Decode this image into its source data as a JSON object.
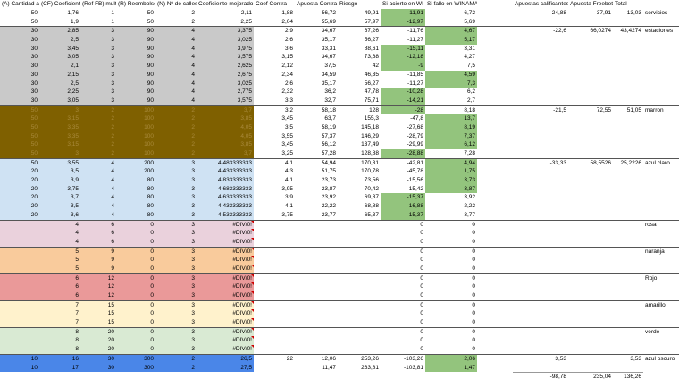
{
  "headers": [
    "(A) Cantidad a",
    "(CF) Coeficient",
    "(Ref FB) multipli",
    "(R) Reembolso",
    "(N) Nº de calles",
    "Coeficiente mejorado",
    "Coef Contra",
    "Apuesta Contra",
    "Riesgo",
    "Si acierto en WI",
    "Si fallo en WINAMAX",
    "",
    "Apuestas calificantes",
    "Apuesta Freebet",
    "Total",
    ""
  ],
  "colors": {
    "gray": "#c9c9c9",
    "brown": "#7f6000",
    "brownText": "#a8893a",
    "lightblue": "#cfe2f3",
    "pink": "#ead1dc",
    "orange": "#f9cb9c",
    "red": "#ea9999",
    "yellow": "#fff2cc",
    "lightgreen": "#d9ead3",
    "blue": "#4a86e8",
    "green": "#93c47d"
  },
  "rows": [
    {
      "g": "white",
      "v": [
        "50",
        "1,76",
        "1",
        "50",
        "2",
        "2,11",
        "1,88",
        "56,72",
        "49,91",
        "-11,91",
        "6,72",
        "",
        "-24,88",
        "37,91",
        "13,03",
        "servicios"
      ],
      "gr": [
        9
      ]
    },
    {
      "g": "white",
      "v": [
        "50",
        "1,9",
        "1",
        "50",
        "2",
        "2,25",
        "2,04",
        "55,69",
        "57,97",
        "-12,97",
        "5,69",
        "",
        "",
        "",
        "",
        ""
      ],
      "gr": [
        9
      ]
    },
    {
      "g": "gray",
      "v": [
        "30",
        "2,85",
        "3",
        "90",
        "4",
        "3,375",
        "2,9",
        "34,67",
        "67,26",
        "-11,76",
        "4,67",
        "",
        "-22,6",
        "66,0274",
        "43,4274",
        "estaciones"
      ],
      "gr": [
        10
      ],
      "sep": true
    },
    {
      "g": "gray",
      "v": [
        "30",
        "2,5",
        "3",
        "90",
        "4",
        "3,025",
        "2,6",
        "35,17",
        "56,27",
        "-11,27",
        "5,17",
        "",
        "",
        "",
        "",
        ""
      ],
      "gr": [
        10
      ]
    },
    {
      "g": "gray",
      "v": [
        "30",
        "3,45",
        "3",
        "90",
        "4",
        "3,975",
        "3,6",
        "33,31",
        "88,61",
        "-15,11",
        "3,31",
        "",
        "",
        "",
        "",
        ""
      ],
      "gr": [
        9
      ]
    },
    {
      "g": "gray",
      "v": [
        "30",
        "3,05",
        "3",
        "90",
        "4",
        "3,575",
        "3,15",
        "34,67",
        "73,68",
        "-12,18",
        "4,27",
        "",
        "",
        "",
        "",
        ""
      ],
      "gr": [
        9
      ]
    },
    {
      "g": "gray",
      "v": [
        "30",
        "2,1",
        "3",
        "90",
        "4",
        "2,625",
        "2,12",
        "37,5",
        "42",
        "-9",
        "7,5",
        "",
        "",
        "",
        "",
        ""
      ],
      "gr": [
        9
      ]
    },
    {
      "g": "gray",
      "v": [
        "30",
        "2,15",
        "3",
        "90",
        "4",
        "2,675",
        "2,34",
        "34,59",
        "46,35",
        "-11,85",
        "4,59",
        "",
        "",
        "",
        "",
        ""
      ],
      "gr": [
        10
      ]
    },
    {
      "g": "gray",
      "v": [
        "30",
        "2,5",
        "3",
        "90",
        "4",
        "3,025",
        "2,6",
        "35,17",
        "56,27",
        "-11,27",
        "7,3",
        "",
        "",
        "",
        "",
        ""
      ],
      "gr": [
        10
      ]
    },
    {
      "g": "gray",
      "v": [
        "30",
        "2,25",
        "3",
        "90",
        "4",
        "2,775",
        "2,32",
        "36,2",
        "47,78",
        "-10,28",
        "6,2",
        "",
        "",
        "",
        "",
        ""
      ],
      "gr": [
        9
      ]
    },
    {
      "g": "gray",
      "v": [
        "30",
        "3,05",
        "3",
        "90",
        "4",
        "3,575",
        "3,3",
        "32,7",
        "75,71",
        "-14,21",
        "2,7",
        "",
        "",
        "",
        "",
        ""
      ],
      "gr": [
        9
      ]
    },
    {
      "g": "brown",
      "v": [
        "50",
        "3",
        "2",
        "100",
        "2",
        "3,7",
        "3,2",
        "58,18",
        "128",
        "-28",
        "8,18",
        "",
        "-21,5",
        "72,55",
        "51,05",
        "marron"
      ],
      "gr": [
        9
      ],
      "sep": true
    },
    {
      "g": "brown",
      "v": [
        "50",
        "3,15",
        "2",
        "100",
        "2",
        "3,85",
        "3,45",
        "63,7",
        "155,3",
        "-47,8",
        "13,7",
        "",
        "",
        "",
        "",
        ""
      ],
      "gr": [
        10
      ]
    },
    {
      "g": "brown",
      "v": [
        "50",
        "3,35",
        "2",
        "100",
        "2",
        "4,05",
        "3,5",
        "58,19",
        "145,18",
        "-27,68",
        "8,19",
        "",
        "",
        "",
        "",
        ""
      ],
      "gr": [
        10
      ]
    },
    {
      "g": "brown",
      "v": [
        "50",
        "3,35",
        "2",
        "100",
        "2",
        "4,05",
        "3,55",
        "57,37",
        "146,29",
        "-28,79",
        "7,37",
        "",
        "",
        "",
        "",
        ""
      ],
      "gr": [
        10
      ]
    },
    {
      "g": "brown",
      "v": [
        "50",
        "3,15",
        "2",
        "100",
        "2",
        "3,85",
        "3,45",
        "56,12",
        "137,49",
        "-29,99",
        "6,12",
        "",
        "",
        "",
        "",
        ""
      ],
      "gr": [
        10
      ]
    },
    {
      "g": "brown",
      "v": [
        "50",
        "3",
        "2",
        "100",
        "2",
        "3,7",
        "3,25",
        "57,28",
        "128,88",
        "-28,88",
        "7,28",
        "",
        "",
        "",
        "",
        ""
      ],
      "gr": [
        9
      ]
    },
    {
      "g": "lightblue",
      "v": [
        "50",
        "3,55",
        "4",
        "200",
        "3",
        "4,483333333",
        "4,1",
        "54,94",
        "170,31",
        "-42,81",
        "4,94",
        "",
        "-33,33",
        "58,5526",
        "25,2226",
        "azul claro"
      ],
      "gr": [
        10
      ],
      "sep": true
    },
    {
      "g": "lightblue",
      "v": [
        "20",
        "3,5",
        "4",
        "200",
        "3",
        "4,433333333",
        "4,3",
        "51,75",
        "170,78",
        "-45,78",
        "1,75",
        "",
        "",
        "",
        "",
        ""
      ],
      "gr": [
        10
      ]
    },
    {
      "g": "lightblue",
      "v": [
        "20",
        "3,9",
        "4",
        "80",
        "3",
        "4,833333333",
        "4,1",
        "23,73",
        "73,56",
        "-15,56",
        "3,73",
        "",
        "",
        "",
        "",
        ""
      ],
      "gr": [
        10
      ]
    },
    {
      "g": "lightblue",
      "v": [
        "20",
        "3,75",
        "4",
        "80",
        "3",
        "4,683333333",
        "3,95",
        "23,87",
        "70,42",
        "-15,42",
        "3,87",
        "",
        "",
        "",
        "",
        ""
      ],
      "gr": [
        10
      ]
    },
    {
      "g": "lightblue",
      "v": [
        "20",
        "3,7",
        "4",
        "80",
        "3",
        "4,633333333",
        "3,9",
        "23,92",
        "69,37",
        "-15,37",
        "3,92",
        "",
        "",
        "",
        "",
        ""
      ],
      "gr": [
        9
      ]
    },
    {
      "g": "lightblue",
      "v": [
        "20",
        "3,5",
        "4",
        "80",
        "3",
        "4,433333333",
        "4,1",
        "22,22",
        "68,88",
        "-16,88",
        "2,22",
        "",
        "",
        "",
        "",
        ""
      ],
      "gr": [
        9
      ]
    },
    {
      "g": "lightblue",
      "v": [
        "20",
        "3,6",
        "4",
        "80",
        "3",
        "4,533333333",
        "3,75",
        "23,77",
        "65,37",
        "-15,37",
        "3,77",
        "",
        "",
        "",
        "",
        ""
      ],
      "gr": [
        9
      ]
    },
    {
      "g": "pink",
      "v": [
        "4",
        "6",
        "0",
        "3",
        "#DIV/0!",
        "",
        "",
        "",
        "0",
        "0",
        "",
        "",
        "",
        "",
        "rosa"
      ],
      "sep": true,
      "div": true
    },
    {
      "g": "pink",
      "v": [
        "4",
        "6",
        "0",
        "3",
        "#DIV/0!",
        "",
        "",
        "",
        "0",
        "0",
        "",
        "",
        "",
        "",
        ""
      ],
      "div": true
    },
    {
      "g": "pink",
      "v": [
        "4",
        "6",
        "0",
        "3",
        "#DIV/0!",
        "",
        "",
        "",
        "0",
        "0",
        "",
        "",
        "",
        "",
        ""
      ],
      "div": true
    },
    {
      "g": "orange",
      "v": [
        "5",
        "9",
        "0",
        "3",
        "#DIV/0!",
        "",
        "",
        "",
        "0",
        "0",
        "",
        "",
        "",
        "",
        "naranja"
      ],
      "sep": true,
      "div": true
    },
    {
      "g": "orange",
      "v": [
        "5",
        "9",
        "0",
        "3",
        "#DIV/0!",
        "",
        "",
        "",
        "0",
        "0",
        "",
        "",
        "",
        "",
        ""
      ],
      "div": true
    },
    {
      "g": "orange",
      "v": [
        "5",
        "9",
        "0",
        "3",
        "#DIV/0!",
        "",
        "",
        "",
        "0",
        "0",
        "",
        "",
        "",
        "",
        ""
      ],
      "div": true
    },
    {
      "g": "red",
      "v": [
        "6",
        "12",
        "0",
        "3",
        "#DIV/0!",
        "",
        "",
        "",
        "0",
        "0",
        "",
        "",
        "",
        "",
        "Rojo"
      ],
      "sep": true,
      "div": true
    },
    {
      "g": "red",
      "v": [
        "6",
        "12",
        "0",
        "3",
        "#DIV/0!",
        "",
        "",
        "",
        "0",
        "0",
        "",
        "",
        "",
        "",
        ""
      ],
      "div": true
    },
    {
      "g": "red",
      "v": [
        "6",
        "12",
        "0",
        "3",
        "#DIV/0!",
        "",
        "",
        "",
        "0",
        "0",
        "",
        "",
        "",
        "",
        ""
      ],
      "div": true
    },
    {
      "g": "yellow",
      "v": [
        "7",
        "15",
        "0",
        "3",
        "#DIV/0!",
        "",
        "",
        "",
        "0",
        "0",
        "",
        "",
        "",
        "",
        "amarillo"
      ],
      "sep": true,
      "div": true
    },
    {
      "g": "yellow",
      "v": [
        "7",
        "15",
        "0",
        "3",
        "#DIV/0!",
        "",
        "",
        "",
        "0",
        "0",
        "",
        "",
        "",
        "",
        ""
      ],
      "div": true
    },
    {
      "g": "yellow",
      "v": [
        "7",
        "15",
        "0",
        "3",
        "#DIV/0!",
        "",
        "",
        "",
        "0",
        "0",
        "",
        "",
        "",
        "",
        ""
      ],
      "div": true
    },
    {
      "g": "lightgreen",
      "v": [
        "8",
        "20",
        "0",
        "3",
        "#DIV/0!",
        "",
        "",
        "",
        "0",
        "0",
        "",
        "",
        "",
        "",
        "verde"
      ],
      "sep": true,
      "div": true
    },
    {
      "g": "lightgreen",
      "v": [
        "8",
        "20",
        "0",
        "3",
        "#DIV/0!",
        "",
        "",
        "",
        "0",
        "0",
        "",
        "",
        "",
        "",
        ""
      ],
      "div": true
    },
    {
      "g": "lightgreen",
      "v": [
        "8",
        "20",
        "0",
        "3",
        "#DIV/0!",
        "",
        "",
        "",
        "0",
        "0",
        "",
        "",
        "",
        "",
        ""
      ],
      "div": true
    },
    {
      "g": "blue",
      "v": [
        "10",
        "16",
        "30",
        "300",
        "2",
        "26,5",
        "22",
        "12,06",
        "253,26",
        "-103,26",
        "2,06",
        "",
        "3,53",
        "",
        "3,53",
        "azul oscuro"
      ],
      "gr": [
        10
      ],
      "sep": true
    },
    {
      "g": "blue",
      "v": [
        "10",
        "17",
        "30",
        "300",
        "2",
        "27,5",
        "",
        "11,47",
        "263,81",
        "-103,81",
        "1,47",
        "",
        "",
        "",
        "",
        ""
      ],
      "gr": [
        10
      ]
    },
    {
      "g": "white",
      "v": [
        "",
        "",
        "",
        "",
        "",
        "",
        "",
        "",
        "",
        "",
        "",
        "",
        "-98,78",
        "235,04",
        "136,26",
        ""
      ],
      "total": true
    }
  ]
}
